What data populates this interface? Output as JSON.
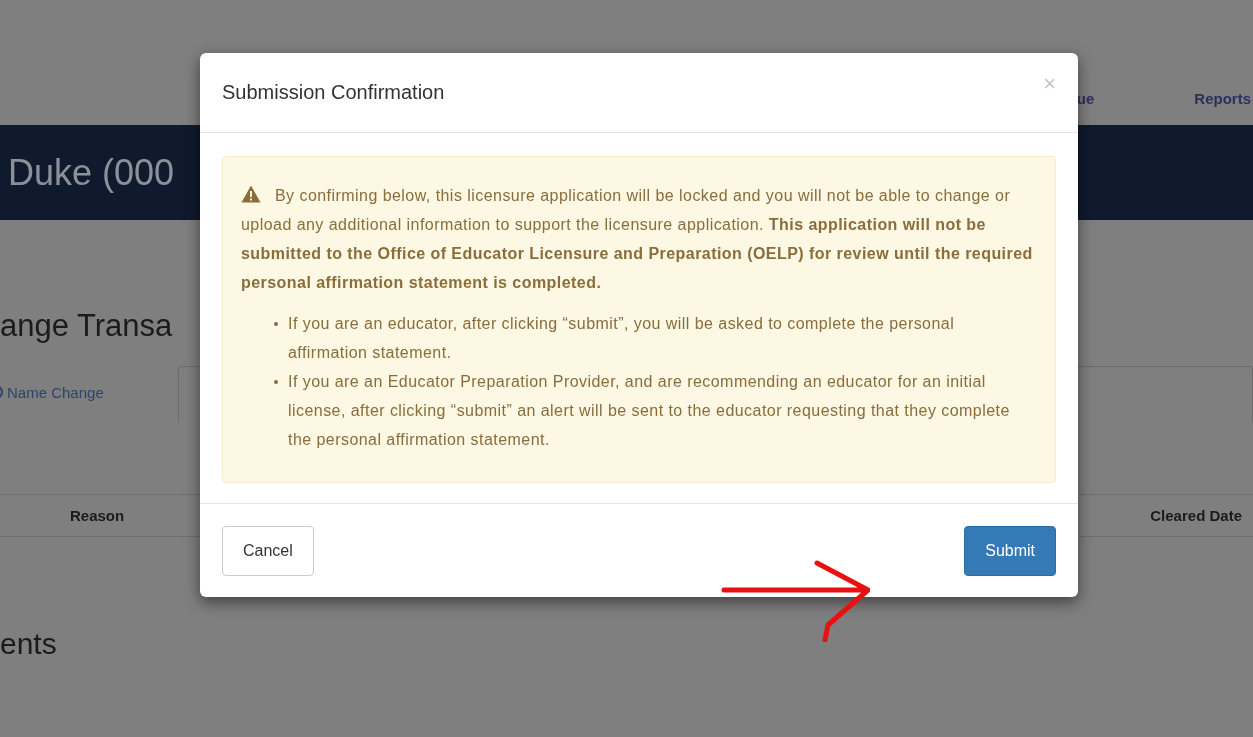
{
  "page": {
    "nav": [
      "ue",
      "Reports"
    ],
    "banner_title": "Duke (000",
    "section_title": "ange Transa",
    "tab": {
      "label": "Name Change"
    },
    "table": {
      "columns": [
        "Reason",
        "Cleared Date"
      ]
    },
    "bottom_title": "ents"
  },
  "modal": {
    "title": "Submission Confirmation",
    "close": "×",
    "alert": {
      "paragraph": "By confirming below, this licensure application will be locked and you will not be able to change or upload any additional information to support the licensure application. **This application will not be submitted to the Office of Educator Licensure and Preparation (OELP) for review until the required personal affirmation statement is completed.**",
      "bullets": [
        "If you are an educator, after clicking “submit”, you will be asked to complete the personal affirmation statement.",
        "If you are an Educator Preparation Provider, and are recommending an educator for an initial license, after clicking “submit” an alert will be sent to the educator requesting that they complete the personal affirmation statement."
      ]
    },
    "buttons": [
      {
        "label": "Cancel",
        "kind": "default"
      },
      {
        "label": "Submit",
        "kind": "primary"
      }
    ]
  }
}
